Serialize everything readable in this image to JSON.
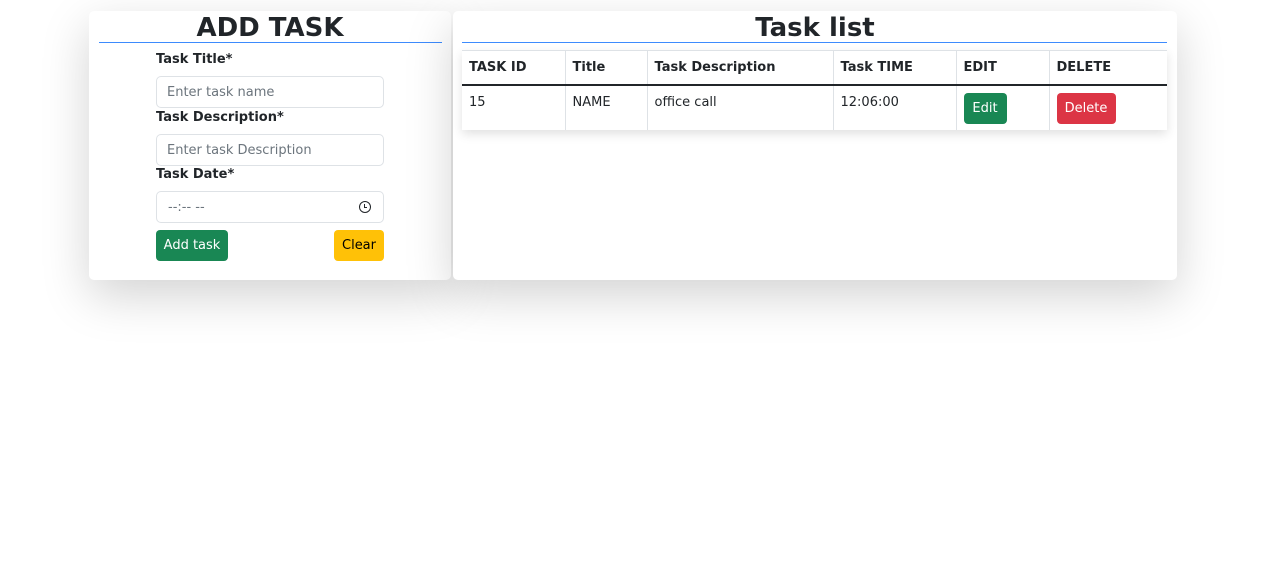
{
  "add_task": {
    "title": "ADD TASK",
    "title_label": "Task Title*",
    "title_placeholder": "Enter task name",
    "description_label": "Task Description*",
    "description_placeholder": "Enter task Description",
    "date_label": "Task Date*",
    "time_value": "--:-- --",
    "add_button": "Add task",
    "clear_button": "Clear"
  },
  "task_list": {
    "title": "Task list",
    "columns": [
      "TASK ID",
      "Title",
      "Task Description",
      "Task TIME",
      "EDIT",
      "DELETE"
    ],
    "rows": [
      {
        "id": "15",
        "title": "NAME",
        "description": "office call",
        "time": "12:06:00",
        "edit_label": "Edit",
        "delete_label": "Delete"
      }
    ]
  },
  "colors": {
    "success": "#198754",
    "warning": "#ffc107",
    "danger": "#dc3545",
    "rule": "#3d8bfd"
  }
}
